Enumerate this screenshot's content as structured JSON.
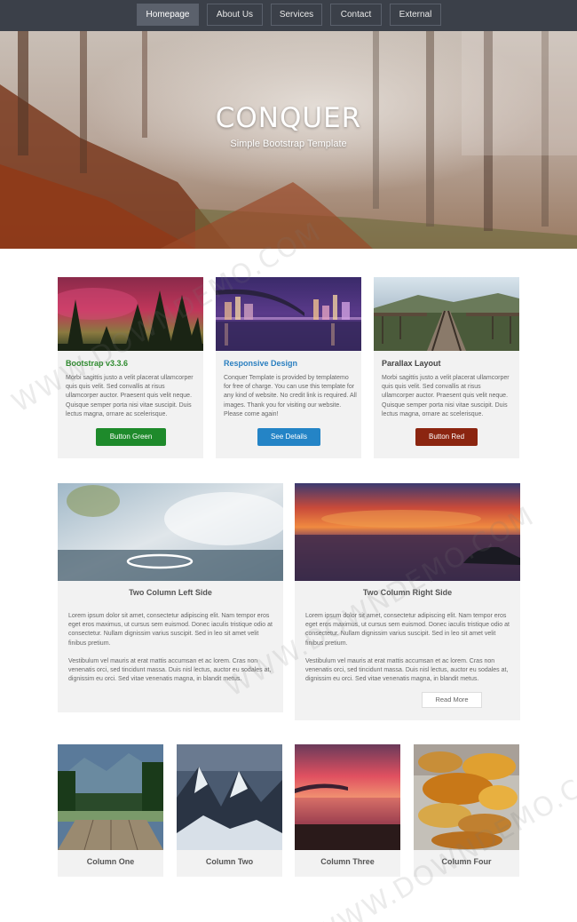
{
  "nav": {
    "items": [
      {
        "label": "Homepage"
      },
      {
        "label": "About Us"
      },
      {
        "label": "Services"
      },
      {
        "label": "Contact"
      },
      {
        "label": "External"
      }
    ]
  },
  "hero": {
    "title": "CONQUER",
    "subtitle": "Simple Bootstrap Template"
  },
  "features": [
    {
      "title": "Bootstrap v3.3.6",
      "title_color": "#2e8b2e",
      "text": "Morbi sagittis justo a velit placerat ullamcorper quis quis velit. Sed convallis at risus ullamcorper auctor. Praesent quis velit neque. Quisque semper porta nisi vitae suscipit. Duis lectus magna, ornare ac scelerisque.",
      "button": "Button Green",
      "button_color": "#1e8a2b"
    },
    {
      "title": "Responsive Design",
      "title_color": "#2a7fc0",
      "text": "Conquer Template is provided by templatemo for free of charge. You can use this template for any kind of website. No credit link is required. All images. Thank you for visiting our website. Please come again!",
      "button": "See Details",
      "button_color": "#2484c6"
    },
    {
      "title": "Parallax Layout",
      "title_color": "#444444",
      "text": "Morbi sagittis justo a velit placerat ullamcorper quis quis velit. Sed convallis at risus ullamcorper auctor. Praesent quis velit neque. Quisque semper porta nisi vitae suscipit. Duis lectus magna, ornare ac scelerisque.",
      "button": "Button Red",
      "button_color": "#8b2510"
    }
  ],
  "two_col": {
    "left": {
      "title": "Two Column Left Side",
      "p1": "Lorem ipsum dolor sit amet, consectetur adipiscing elit. Nam tempor eros eget eros maximus, ut cursus sem euismod. Donec iaculis tristique odio at consectetur. Nullam dignissim varius suscipit. Sed in leo sit amet velit finibus pretium.",
      "p2": "Vestibulum vel mauris at erat mattis accumsan et ac lorem. Cras non venenatis orci, sed tincidunt massa. Duis nisl lectus, auctor eu sodales at, dignissim eu orci. Sed vitae venenatis magna, in blandit metus."
    },
    "right": {
      "title": "Two Column Right Side",
      "p1": "Lorem ipsum dolor sit amet, consectetur adipiscing elit. Nam tempor eros eget eros maximus, ut cursus sem euismod. Donec iaculis tristique odio at consectetur. Nullam dignissim varius suscipit. Sed in leo sit amet velit finibus pretium.",
      "p2": "Vestibulum vel mauris at erat mattis accumsan et ac lorem. Cras non venenatis orci, sed tincidunt massa. Duis nisl lectus, auctor eu sodales at, dignissim eu orci. Sed vitae venenatis magna, in blandit metus.",
      "button": "Read More"
    }
  },
  "four_col": [
    {
      "title": "Column One"
    },
    {
      "title": "Column Two"
    },
    {
      "title": "Column Three"
    },
    {
      "title": "Column Four"
    }
  ],
  "watermark": "WWW.DOWNDEMO.COM"
}
